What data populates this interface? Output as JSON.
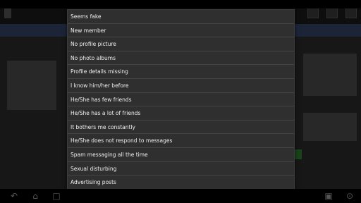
{
  "report_dialog": {
    "options": [
      "Seems fake",
      "New member",
      "No profile picture",
      "No photo albums",
      "Profile details missing",
      "I know him/her before",
      "He/She has few friends",
      "He/She has a lot of friends",
      "It bothers me constantly",
      "He/She does not respond to messages",
      "Spam messaging all the time",
      "Sexual disturbing",
      "Advertising posts"
    ]
  },
  "system_nav": {
    "icons": [
      "back-icon",
      "home-icon",
      "recent-apps-icon",
      "screenshot-icon",
      "settings-icon"
    ]
  }
}
